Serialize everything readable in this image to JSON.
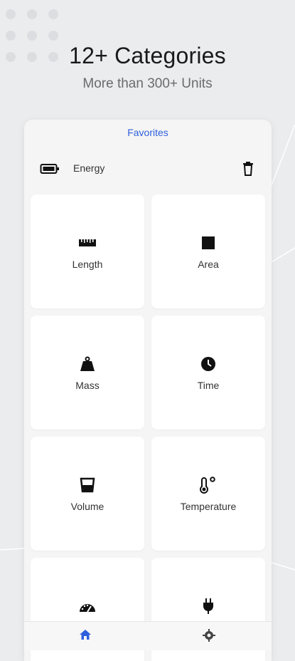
{
  "promo": {
    "title": "12+ Categories",
    "subtitle": "More than 300+ Units"
  },
  "favorites": {
    "header": "Favorites",
    "items": [
      {
        "label": "Energy",
        "icon": "battery-icon"
      }
    ]
  },
  "categories": [
    {
      "label": "Length",
      "icon": "ruler-icon"
    },
    {
      "label": "Area",
      "icon": "square-icon"
    },
    {
      "label": "Mass",
      "icon": "weight-icon"
    },
    {
      "label": "Time",
      "icon": "clock-icon"
    },
    {
      "label": "Volume",
      "icon": "cup-icon"
    },
    {
      "label": "Temperature",
      "icon": "thermometer-icon"
    },
    {
      "label": "",
      "icon": "speedometer-icon"
    },
    {
      "label": "",
      "icon": "plug-icon"
    }
  ],
  "bottom_nav": [
    {
      "name": "home",
      "icon": "home-icon",
      "active": true
    },
    {
      "name": "settings",
      "icon": "gear-icon",
      "active": false
    }
  ],
  "colors": {
    "accent": "#2f5fdd",
    "background": "#ebecee",
    "card": "#ffffff"
  }
}
